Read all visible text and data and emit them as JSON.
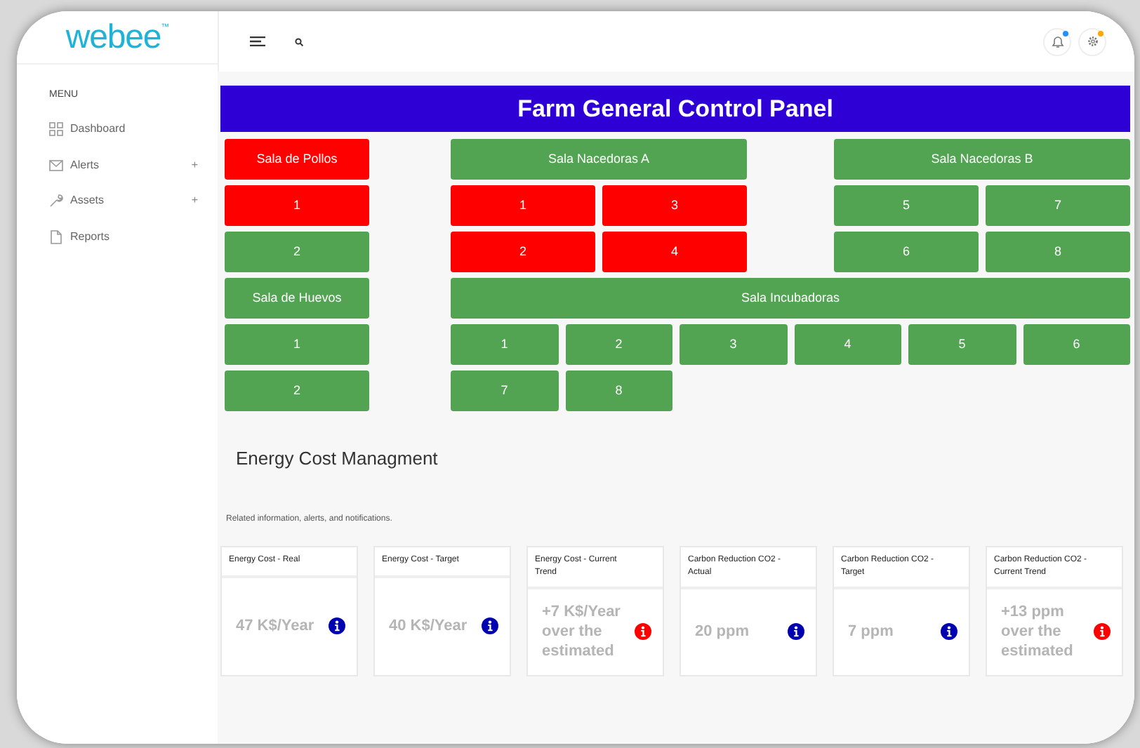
{
  "sidebar": {
    "logo": "webee",
    "logo_mark": "™",
    "menu_heading": "MENU",
    "items": [
      {
        "label": "Dashboard"
      },
      {
        "label": "Alerts",
        "toggle": "+"
      },
      {
        "label": "Assets",
        "toggle": "+"
      },
      {
        "label": "Reports"
      }
    ]
  },
  "panel": {
    "title": "Farm General Control Panel",
    "left_column": [
      {
        "name": "Sala de Pollos",
        "alarm": true,
        "units": [
          {
            "label": "1",
            "alarm": true
          },
          {
            "label": "2",
            "alarm": false
          }
        ]
      },
      {
        "name": "Sala de Huevos",
        "alarm": false,
        "units": [
          {
            "label": "1",
            "alarm": false
          },
          {
            "label": "2",
            "alarm": false
          }
        ]
      }
    ],
    "hatchers": [
      {
        "name": "Sala Nacedoras A",
        "alarm": false,
        "units": [
          {
            "label": "1",
            "alarm": true
          },
          {
            "label": "3",
            "alarm": true
          },
          {
            "label": "2",
            "alarm": true
          },
          {
            "label": "4",
            "alarm": true
          }
        ]
      },
      {
        "name": "Sala Nacedoras B",
        "alarm": false,
        "units": [
          {
            "label": "5",
            "alarm": false
          },
          {
            "label": "7",
            "alarm": false
          },
          {
            "label": "6",
            "alarm": false
          },
          {
            "label": "8",
            "alarm": false
          }
        ]
      }
    ],
    "incubator": {
      "name": "Sala Incubadoras",
      "alarm": false,
      "units": [
        {
          "label": "1",
          "alarm": false
        },
        {
          "label": "2",
          "alarm": false
        },
        {
          "label": "3",
          "alarm": false
        },
        {
          "label": "4",
          "alarm": false
        },
        {
          "label": "5",
          "alarm": false
        },
        {
          "label": "6",
          "alarm": false
        },
        {
          "label": "7",
          "alarm": false
        },
        {
          "label": "8",
          "alarm": false
        }
      ]
    }
  },
  "energy": {
    "title": "Energy Cost Managment",
    "subtitle": "Related information, alerts, and notifications.",
    "cards": [
      {
        "title": "Energy Cost - Real",
        "value": "47 K$/Year",
        "alert": false
      },
      {
        "title": "Energy Cost - Target",
        "value": "40 K$/Year",
        "alert": false
      },
      {
        "title": "Energy Cost - Current Trend",
        "value": "+7 K$/Year over the estimated",
        "alert": true
      },
      {
        "title": "Carbon Reduction CO2 - Actual",
        "value": "20 ppm",
        "alert": false
      },
      {
        "title": "Carbon Reduction CO2 - Target",
        "value": "7 ppm",
        "alert": false
      },
      {
        "title": "Carbon Reduction CO2 - Current Trend",
        "value": "+13 ppm over the estimated",
        "alert": true
      }
    ]
  }
}
